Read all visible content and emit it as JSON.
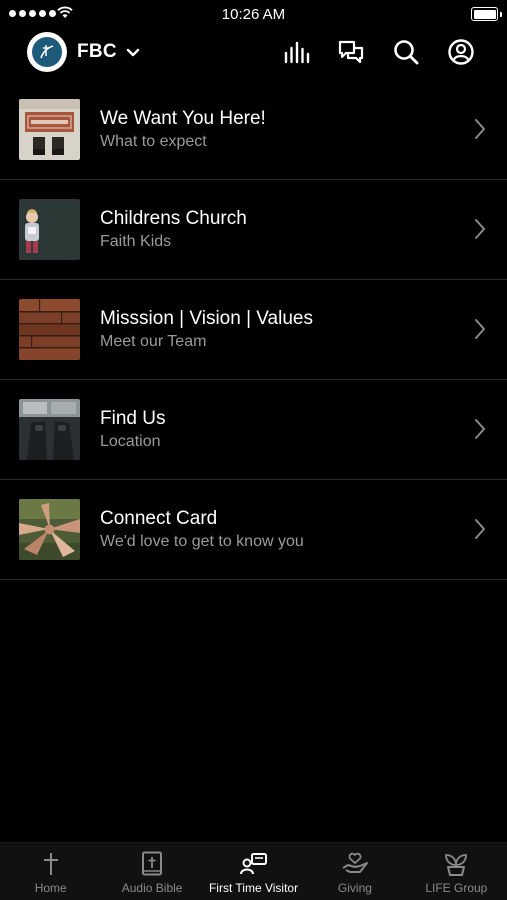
{
  "status_bar": {
    "time": "10:26 AM"
  },
  "header": {
    "org_name": "FBC",
    "icons": [
      "audio-bars-icon",
      "chat-icon",
      "search-icon",
      "profile-icon"
    ]
  },
  "list": {
    "items": [
      {
        "title": "We Want You Here!",
        "subtitle": "What to expect"
      },
      {
        "title": "Childrens Church",
        "subtitle": "Faith Kids"
      },
      {
        "title": "Misssion | Vision | Values",
        "subtitle": "Meet our Team"
      },
      {
        "title": "Find Us",
        "subtitle": "Location"
      },
      {
        "title": "Connect Card",
        "subtitle": "We'd love to get to know you"
      }
    ]
  },
  "tab_bar": {
    "tabs": [
      {
        "label": "Home",
        "icon": "cross-icon"
      },
      {
        "label": "Audio Bible",
        "icon": "bible-icon"
      },
      {
        "label": "First Time Visitor",
        "icon": "visitor-icon",
        "active": true
      },
      {
        "label": "Giving",
        "icon": "giving-hand-icon"
      },
      {
        "label": "LIFE Group",
        "icon": "plant-icon"
      }
    ]
  },
  "colors": {
    "background": "#000000",
    "subtitle": "#9a9a9a",
    "tab_inactive": "#8a8a8a",
    "tab_active": "#ffffff",
    "divider": "#2a2a2a"
  }
}
